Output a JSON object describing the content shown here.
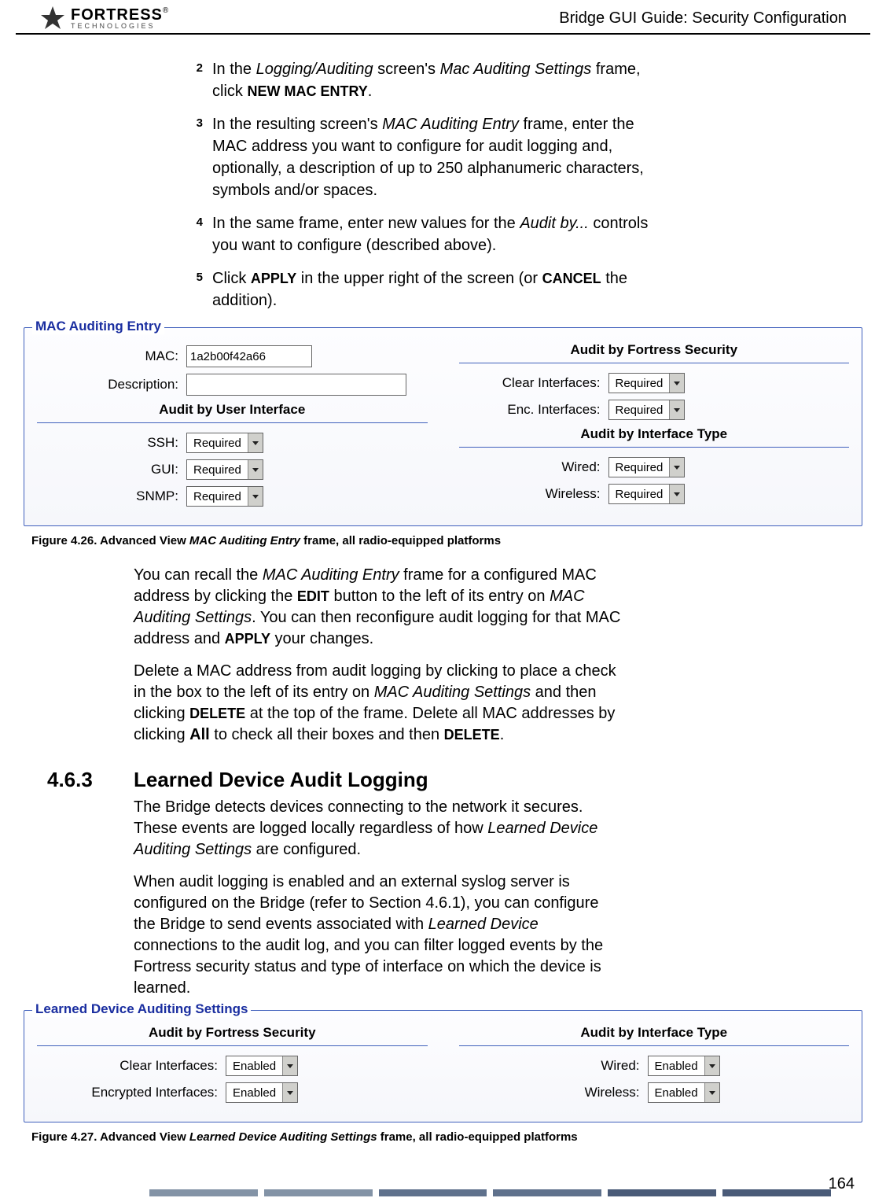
{
  "header": {
    "brand_main": "FORTRESS",
    "brand_reg": "®",
    "brand_sub": "TECHNOLOGIES",
    "title": "Bridge GUI Guide: Security Configuration"
  },
  "steps": [
    {
      "num": "2",
      "pre": "In the ",
      "i1": "Logging/Auditing",
      "mid1": " screen's ",
      "i2": "Mac Auditing Settings",
      "mid2": " frame, click ",
      "sc1": "NEW MAC ENTRY",
      "post": "."
    },
    {
      "num": "3",
      "pre": "In the resulting screen's ",
      "i1": "MAC Auditing Entry",
      "mid1": " frame, enter the MAC address you want to configure for audit logging and, optionally, a description of up to 250 alphanumeric characters, symbols and/or spaces.",
      "i2": "",
      "mid2": "",
      "sc1": "",
      "post": ""
    },
    {
      "num": "4",
      "pre": "In the same frame, enter new values for the ",
      "i1": "Audit by...",
      "mid1": " controls you want to configure (described above).",
      "i2": "",
      "mid2": "",
      "sc1": "",
      "post": ""
    },
    {
      "num": "5",
      "pre": "Click ",
      "sc1": "APPLY",
      "mid1": " in the upper right of the screen (or ",
      "sc2": "CANCEL",
      "mid2": " the addition).",
      "i1": "",
      "i2": "",
      "post": ""
    }
  ],
  "panel1": {
    "legend": "MAC Auditing Entry",
    "mac_label": "MAC:",
    "mac_value": "1a2b00f42a66",
    "desc_label": "Description:",
    "desc_value": "",
    "left_title": "Audit by User Interface",
    "right_title1": "Audit by Fortress Security",
    "right_title2": "Audit by Interface Type",
    "rows_left": [
      {
        "label": "SSH:",
        "value": "Required"
      },
      {
        "label": "GUI:",
        "value": "Required"
      },
      {
        "label": "SNMP:",
        "value": "Required"
      }
    ],
    "rows_right1": [
      {
        "label": "Clear Interfaces:",
        "value": "Required"
      },
      {
        "label": "Enc. Interfaces:",
        "value": "Required"
      }
    ],
    "rows_right2": [
      {
        "label": "Wired:",
        "value": "Required"
      },
      {
        "label": "Wireless:",
        "value": "Required"
      }
    ]
  },
  "fig1": {
    "lead": "Figure 4.26. Advanced View ",
    "ital": "MAC Auditing Entry",
    "tail": " frame, all radio-equipped platforms"
  },
  "para1": {
    "t1": "You can recall the ",
    "i1": "MAC Auditing Entry",
    "t2": " frame for a configured MAC address by clicking the ",
    "sc1": "EDIT",
    "t3": " button to the left of its entry on ",
    "i2": "MAC Auditing Settings",
    "t4": ". You can then reconfigure audit logging for that MAC address and ",
    "sc2": "APPLY",
    "t5": " your changes."
  },
  "para2": {
    "t1": "Delete a MAC address from audit logging by clicking to place a check in the box to the left of its entry on ",
    "i1": "MAC Auditing Settings",
    "t2": " and then clicking ",
    "sc1": "DELETE",
    "t3": " at the top of the frame. Delete all MAC addresses by clicking ",
    "b1": "All",
    "t4": " to check all their boxes and then ",
    "sc2": "DELETE",
    "t5": "."
  },
  "section": {
    "num": "4.6.3",
    "title": "Learned Device Audit Logging"
  },
  "para3": {
    "t1": "The Bridge detects devices connecting to the network it secures. These events are logged locally regardless of how ",
    "i1": "Learned Device Auditing Settings",
    "t2": " are configured."
  },
  "para4": {
    "t1": " When audit logging is enabled and an external syslog server is configured on the Bridge (refer to Section 4.6.1), you can configure the Bridge to send events associated with ",
    "i1": "Learned Device",
    "t2": " connections to the audit log, and you can filter logged events by the Fortress security status and type of interface on which the device is learned."
  },
  "panel2": {
    "legend": "Learned Device Auditing Settings",
    "left_title": "Audit by Fortress Security",
    "right_title": "Audit by Interface Type",
    "rows_left": [
      {
        "label": "Clear Interfaces:",
        "value": "Enabled"
      },
      {
        "label": "Encrypted Interfaces:",
        "value": "Enabled"
      }
    ],
    "rows_right": [
      {
        "label": "Wired:",
        "value": "Enabled"
      },
      {
        "label": "Wireless:",
        "value": "Enabled"
      }
    ]
  },
  "fig2": {
    "lead": "Figure 4.27. Advanced View ",
    "ital": "Learned Device Auditing Settings",
    "tail": " frame, all radio-equipped platforms"
  },
  "page_num": "164"
}
